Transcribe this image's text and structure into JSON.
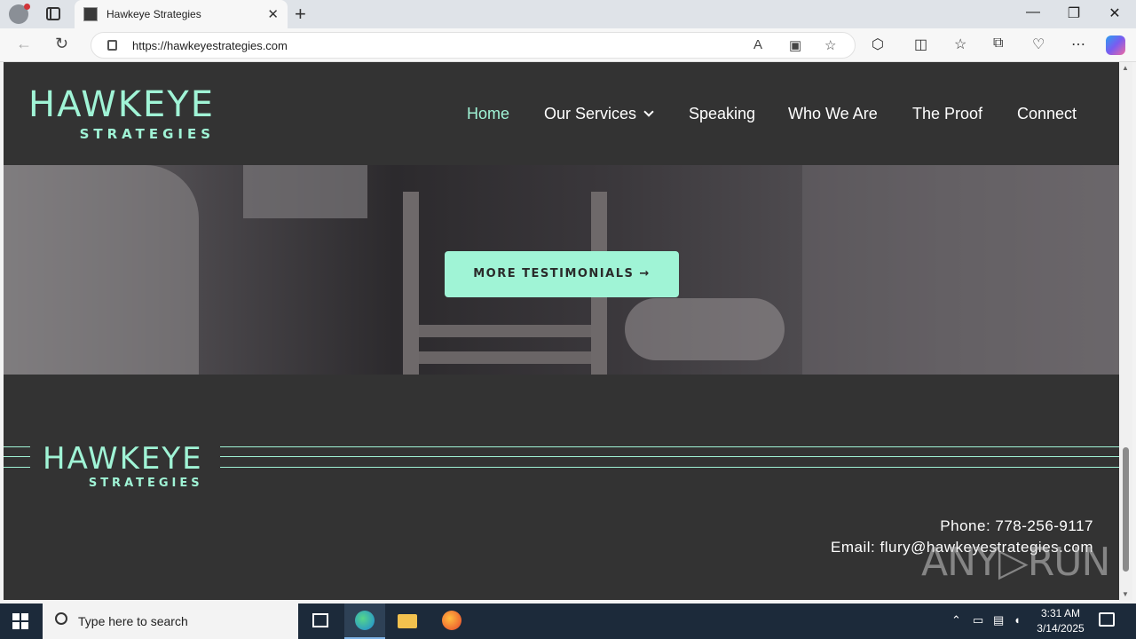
{
  "browser": {
    "tab_title": "Hawkeye Strategies",
    "tab_close": "✕",
    "new_tab": "+",
    "url": "https://hawkeyestrategies.com",
    "window_controls": {
      "minimize": "—",
      "restore": "❐",
      "close": "✕"
    },
    "icons": [
      "back-icon",
      "refresh-icon",
      "lock-icon",
      "read-aloud-icon",
      "immersive-reader-icon",
      "favorite-star-icon",
      "extensions-icon",
      "split-screen-icon",
      "favorites-icon",
      "collections-icon",
      "browser-essentials-icon",
      "more-icon",
      "copilot-icon"
    ]
  },
  "site": {
    "logo": {
      "main": "HAWKEYE",
      "sub": "STRATEGIES"
    },
    "nav": [
      {
        "label": "Home",
        "active": true
      },
      {
        "label": "Our Services",
        "has_dropdown": true
      },
      {
        "label": "Speaking"
      },
      {
        "label": "Who We Are"
      },
      {
        "label": "The Proof"
      },
      {
        "label": "Connect"
      }
    ],
    "cta_label": "MORE TESTIMONIALS →",
    "footer": {
      "logo": {
        "main": "HAWKEYE",
        "sub": "STRATEGIES"
      },
      "phone": "Phone: 778-256-9117",
      "email": "Email: flury@hawkeyestrategies.com"
    },
    "accent_color": "#a0f4d6",
    "background_color": "#333333"
  },
  "watermark": "ANY▷RUN",
  "taskbar": {
    "search_placeholder": "Type here to search",
    "time": "3:31 AM",
    "date": "3/14/2025",
    "apps": [
      "task-view-icon",
      "edge-icon",
      "file-explorer-icon",
      "firefox-icon"
    ]
  }
}
